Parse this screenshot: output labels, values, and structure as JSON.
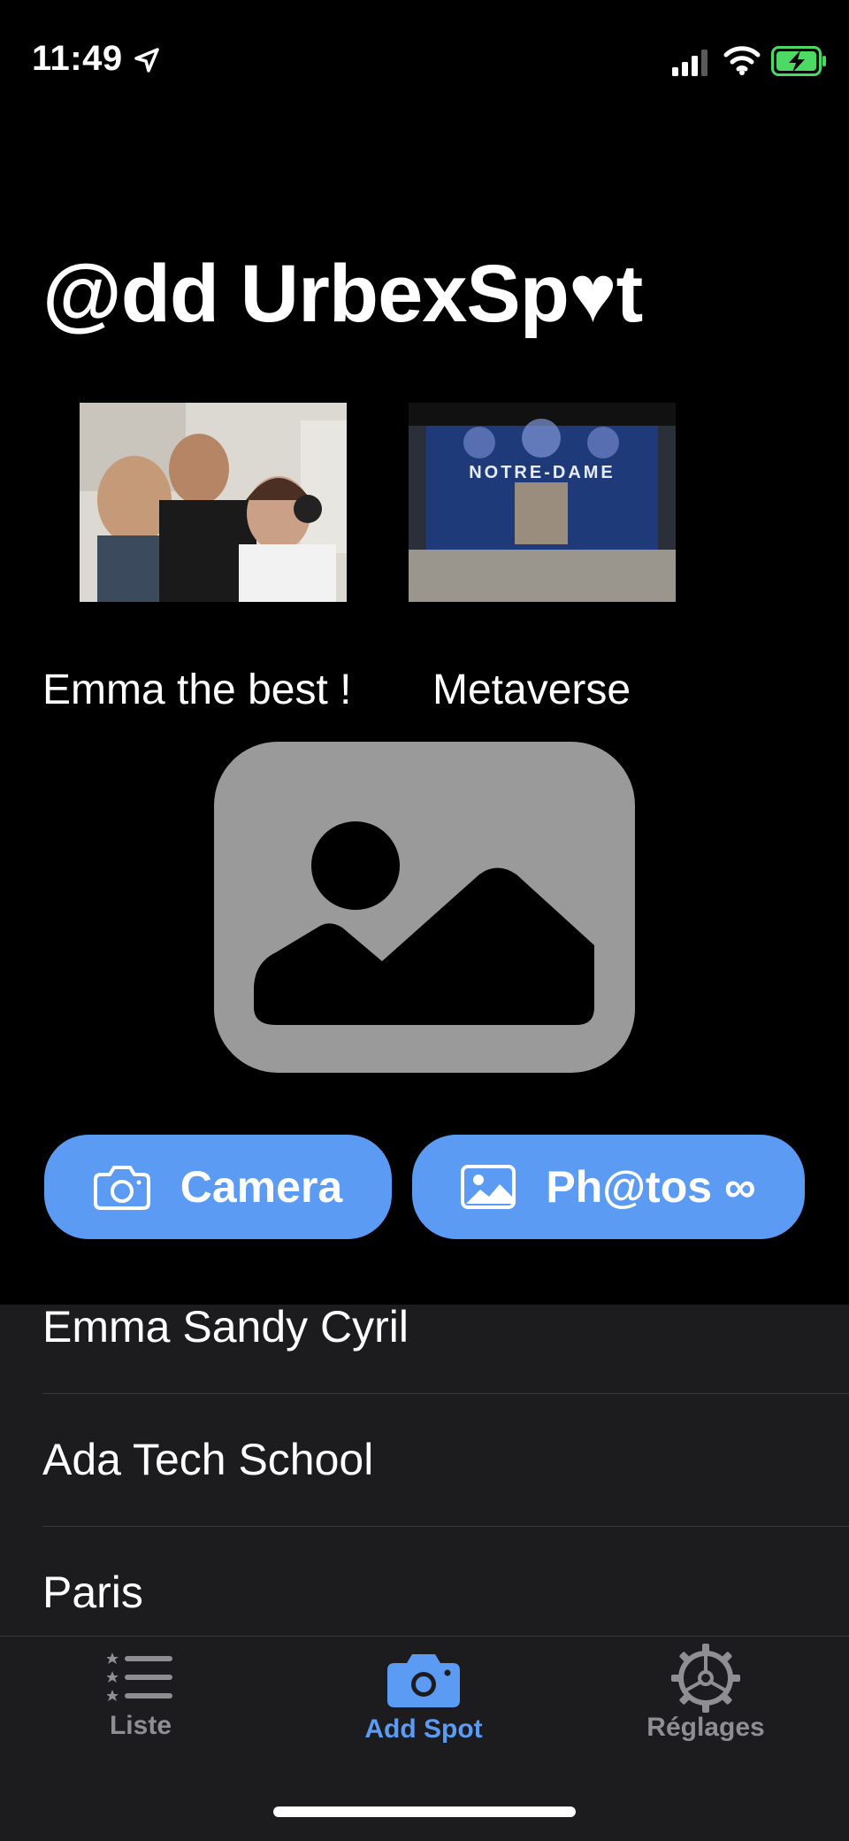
{
  "status_bar": {
    "time": "11:49"
  },
  "page": {
    "title": "@dd UrbexSp♥t"
  },
  "spots": [
    {
      "caption": "Emma the best !"
    },
    {
      "caption": "Metaverse",
      "poster_text": "NOTRE-DAME"
    }
  ],
  "actions": {
    "camera_label": "Camera",
    "photos_label": "Ph@tos ∞"
  },
  "form_list": [
    "Emma Sandy Cyril",
    "Ada Tech School",
    "Paris"
  ],
  "tabs": [
    {
      "label": "Liste",
      "icon": "list-icon",
      "active": false
    },
    {
      "label": "Add Spot",
      "icon": "camera-icon",
      "active": true
    },
    {
      "label": "Réglages",
      "icon": "gear-icon",
      "active": false
    }
  ],
  "colors": {
    "accent": "#5b9bf3",
    "placeholder_gray": "#9a9a9a",
    "panel": "#1c1c1e",
    "battery_green": "#4cd964"
  }
}
